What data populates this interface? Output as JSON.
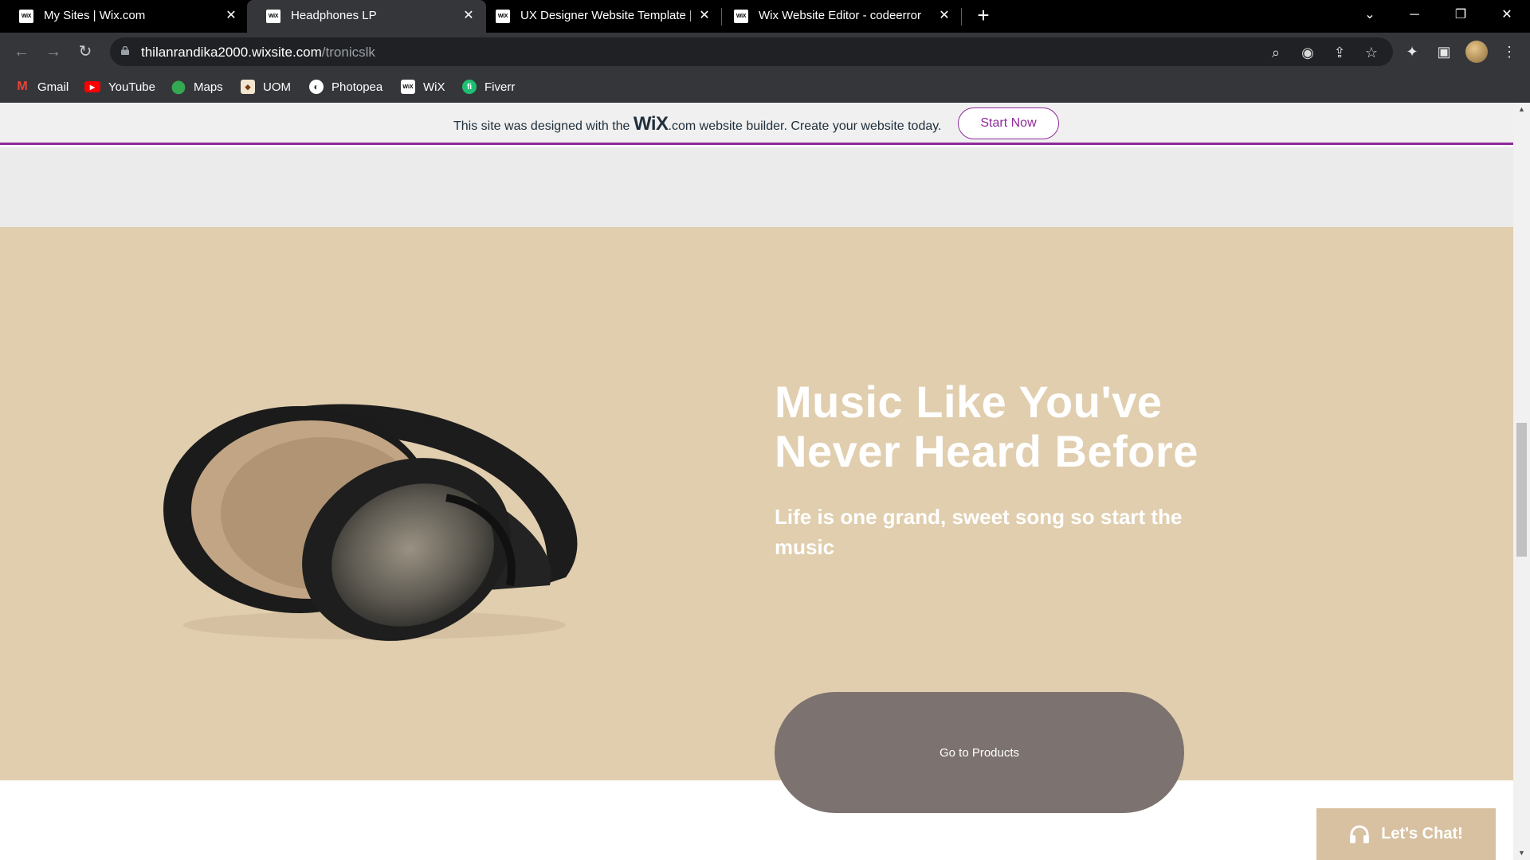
{
  "browser": {
    "tabs": [
      {
        "title": "My Sites | Wix.com",
        "favicon": "WiX",
        "active": false
      },
      {
        "title": "Headphones LP",
        "favicon": "WiX",
        "active": true
      },
      {
        "title": "UX Designer Website Template | ",
        "favicon": "WiX",
        "active": false
      },
      {
        "title": "Wix Website Editor - codeerror",
        "favicon": "WiX",
        "active": false
      }
    ],
    "new_tab_label": "+",
    "url_host": "thilanrandika2000.wixsite.com",
    "url_path": "/tronicslk",
    "bookmarks": [
      {
        "label": "Gmail",
        "icon": "gmail-icon"
      },
      {
        "label": "YouTube",
        "icon": "youtube-icon"
      },
      {
        "label": "Maps",
        "icon": "maps-icon"
      },
      {
        "label": "UOM",
        "icon": "uom-icon"
      },
      {
        "label": "Photopea",
        "icon": "photopea-icon"
      },
      {
        "label": "WiX",
        "icon": "wix-icon"
      },
      {
        "label": "Fiverr",
        "icon": "fiverr-icon"
      }
    ]
  },
  "wix_banner": {
    "prefix": "This site was designed with the ",
    "logo": "WiX",
    "suffix": ".com website builder. Create your website today.",
    "button": "Start Now",
    "accent": "#8e2a9a"
  },
  "hero": {
    "title_line1": "Music Like You've",
    "title_line2": "Never Heard Before",
    "subtitle": "Life is one grand, sweet song so start the music",
    "cta": "Go to Products",
    "background": "#e0ceae",
    "cta_color": "#7c7270"
  },
  "chat": {
    "label": "Let's Chat!",
    "color": "#d8c1a1"
  }
}
